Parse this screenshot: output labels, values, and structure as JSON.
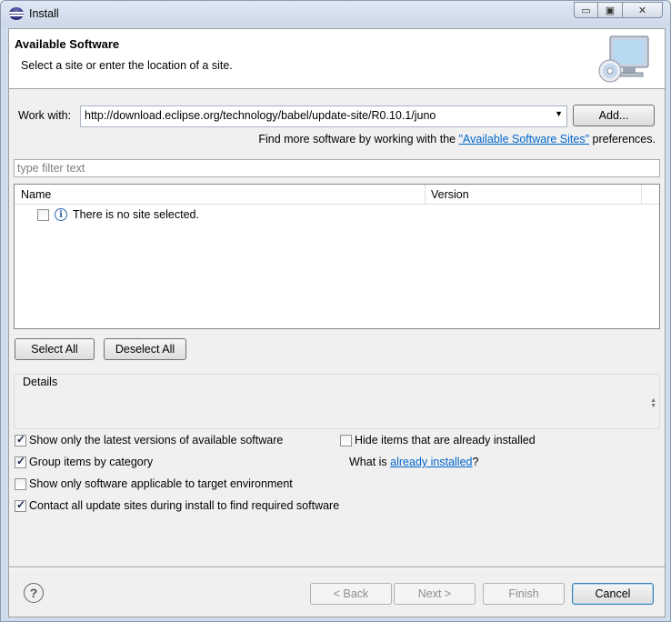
{
  "window": {
    "title": "Install",
    "minimize_glyph": "▭",
    "maximize_glyph": "▣",
    "close_glyph": "✕"
  },
  "header": {
    "title": "Available Software",
    "description": "Select a site or enter the location of a site."
  },
  "work_with": {
    "label": "Work with:",
    "value": "http://download.eclipse.org/technology/babel/update-site/R0.10.1/juno",
    "add_label": "Add...",
    "find_more_prefix": "Find more software by working with the ",
    "find_more_link": "\"Available Software Sites\"",
    "find_more_suffix": " preferences."
  },
  "filter": {
    "placeholder": "type filter text"
  },
  "tree": {
    "columns": [
      "Name",
      "Version"
    ],
    "rows": [
      {
        "checked": false,
        "icon": "info-icon",
        "text": "There is no site selected."
      }
    ]
  },
  "buttons": {
    "select_all": "Select All",
    "deselect_all": "Deselect All"
  },
  "details": {
    "label": "Details"
  },
  "options": [
    {
      "label": "Show only the latest versions of available software",
      "checked": true
    },
    {
      "label": "Group items by category",
      "checked": true
    },
    {
      "label": "Show only software applicable to target environment",
      "checked": false
    },
    {
      "label": "Contact all update sites during install to find required software",
      "checked": true
    },
    {
      "label": "Hide items that are already installed",
      "checked": false
    }
  ],
  "what_is": {
    "prefix": "What is ",
    "link": "already installed",
    "suffix": "?"
  },
  "footer": {
    "help": "?",
    "back": "< Back",
    "next": "Next >",
    "finish": "Finish",
    "cancel": "Cancel"
  }
}
